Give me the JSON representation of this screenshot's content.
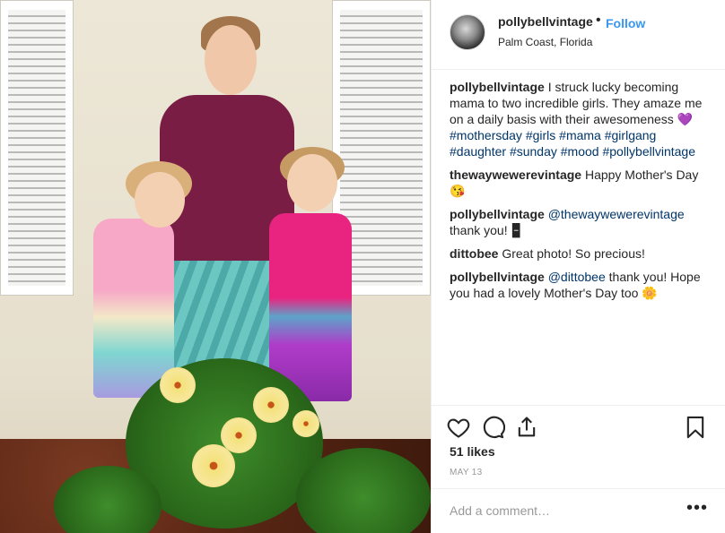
{
  "post": {
    "username": "pollybellvintage",
    "location": "Palm Coast, Florida",
    "follow_label": "Follow",
    "dot": "•"
  },
  "comments": [
    {
      "user": "pollybellvintage",
      "text": "I struck lucky becoming mama to two incredible girls. They amaze me on a daily basis with their awesomeness 💜",
      "hashtags": "#mothersday #girls #mama #girlgang #daughter #sunday #mood #pollybellvintage"
    },
    {
      "user": "thewaywewerevintage",
      "text": "Happy Mother's Day 😘"
    },
    {
      "user": "pollybellvintage",
      "mention": "@thewaywewerevintage",
      "text": "thank you! 🁢"
    },
    {
      "user": "dittobee",
      "text": "Great photo! So precious!"
    },
    {
      "user": "pollybellvintage",
      "mention": "@dittobee",
      "text": "thank you! Hope you had a lovely Mother's Day too 🌼"
    }
  ],
  "actions": {
    "like_icon": "heart-icon",
    "comment_icon": "comment-icon",
    "share_icon": "share-icon",
    "save_icon": "bookmark-icon"
  },
  "likes": "51 likes",
  "date": "MAY 13",
  "add_comment": {
    "placeholder": "Add a comment…",
    "more_label": "•••"
  },
  "colors": {
    "link": "#3897f0",
    "hashtag": "#003569",
    "text": "#262626",
    "muted": "#999999"
  }
}
